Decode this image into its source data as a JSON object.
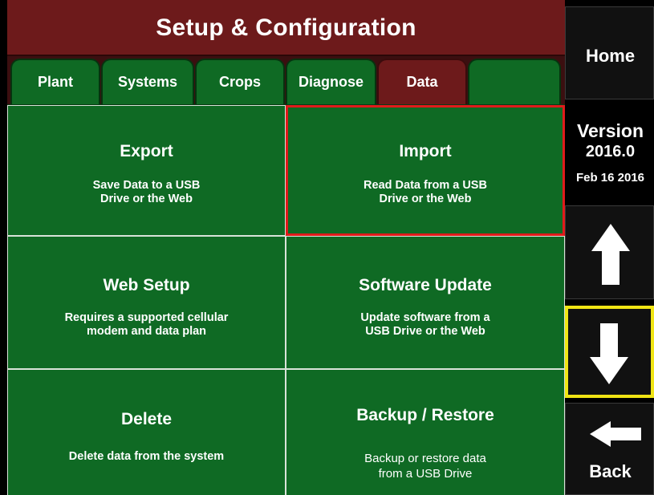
{
  "header": {
    "title": "Setup & Configuration"
  },
  "tabs": [
    {
      "label": "Plant",
      "active": false
    },
    {
      "label": "Systems",
      "active": false
    },
    {
      "label": "Crops",
      "active": false
    },
    {
      "label": "Diagnose",
      "active": false
    },
    {
      "label": "Data",
      "active": true
    },
    {
      "label": "",
      "active": false
    }
  ],
  "tiles": {
    "export": {
      "title": "Export",
      "sub_line1": "Save Data to a USB",
      "sub_line2": "Drive or the Web"
    },
    "import": {
      "title": "Import",
      "sub_line1": "Read Data from a USB",
      "sub_line2": "Drive or the Web"
    },
    "web_setup": {
      "title": "Web Setup",
      "sub_line1": "Requires a supported cellular",
      "sub_line2": "modem and data plan"
    },
    "software_update": {
      "title": "Software Update",
      "sub_line1": "Update software from a",
      "sub_line2": "USB Drive or the Web"
    },
    "delete": {
      "title": "Delete",
      "sub_line1": "Delete data from the system"
    },
    "backup_restore": {
      "title": "Backup / Restore",
      "sub_line1": "Backup or restore data",
      "sub_line2": "from a USB Drive"
    }
  },
  "side": {
    "home_label": "Home",
    "version_label": "Version",
    "version_number": "2016.0",
    "version_date": "Feb 16 2016",
    "scroll_up_icon": "arrow-up-icon",
    "scroll_down_icon": "arrow-down-icon",
    "back_label": "Back",
    "back_icon": "arrow-left-icon"
  },
  "colors": {
    "header_bg": "#6d1a1b",
    "tile_bg": "#0f6a24",
    "selection_outline": "#e01b1b",
    "focus_outline": "#f0e414",
    "side_bg": "#111111"
  }
}
